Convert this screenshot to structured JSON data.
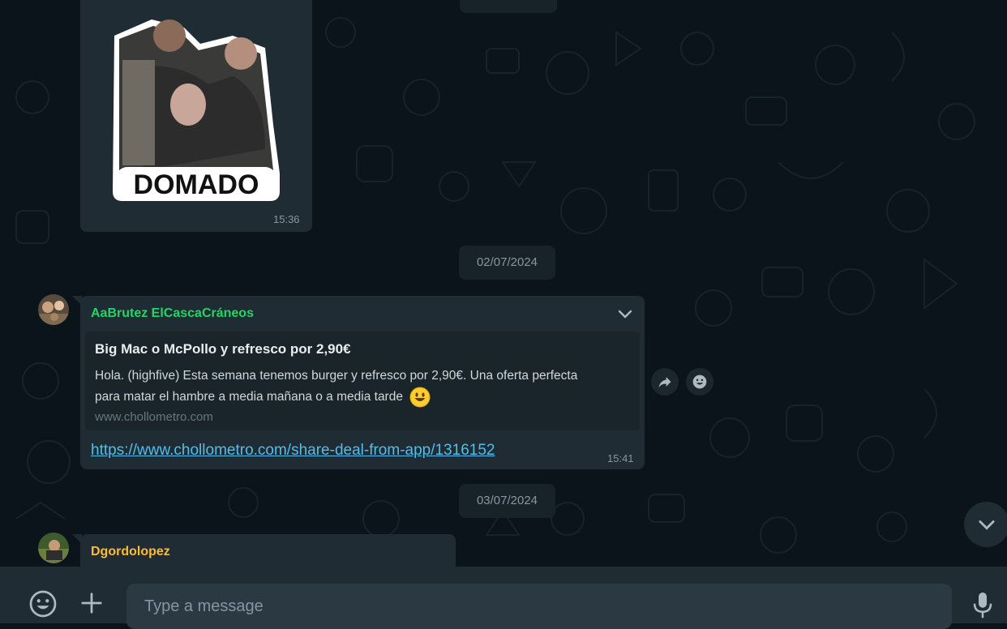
{
  "messages": [
    {
      "sticker_text": "DOMADO",
      "time": "15:36"
    },
    {
      "date": "02/07/2024"
    },
    {
      "sender": "AaBrutez ElCascaCráneos",
      "sender_color": "#25d366",
      "preview_title": "Big Mac o McPollo y refresco por 2,90€",
      "preview_desc_line1": "Hola. (highfive) Esta semana tenemos burger y refresco por 2,90€. Una oferta perfecta",
      "preview_desc_line2": "para matar el hambre a media mañana o a media tarde",
      "preview_emoji": "smiley-face-emoji",
      "preview_domain": "www.chollometro.com",
      "link": "https://www.chollometro.com/share-deal-from-app/1316152",
      "time": "15:41"
    },
    {
      "date": "03/07/2024"
    },
    {
      "sender": "Dgordolopez",
      "sender_color": "#ffbc38"
    }
  ],
  "composer": {
    "placeholder": "Type a message",
    "emoji_icon": "emoji-icon",
    "attach_icon": "plus-icon",
    "mic_icon": "microphone-icon"
  },
  "actions": {
    "forward_icon": "forward-icon",
    "react_icon": "emoji-react-icon",
    "scroll_down_icon": "chevron-down-icon"
  },
  "colors": {
    "bubble": "#202c33",
    "background": "#0b141a",
    "link": "#53bdeb",
    "meta": "#8696a0"
  }
}
